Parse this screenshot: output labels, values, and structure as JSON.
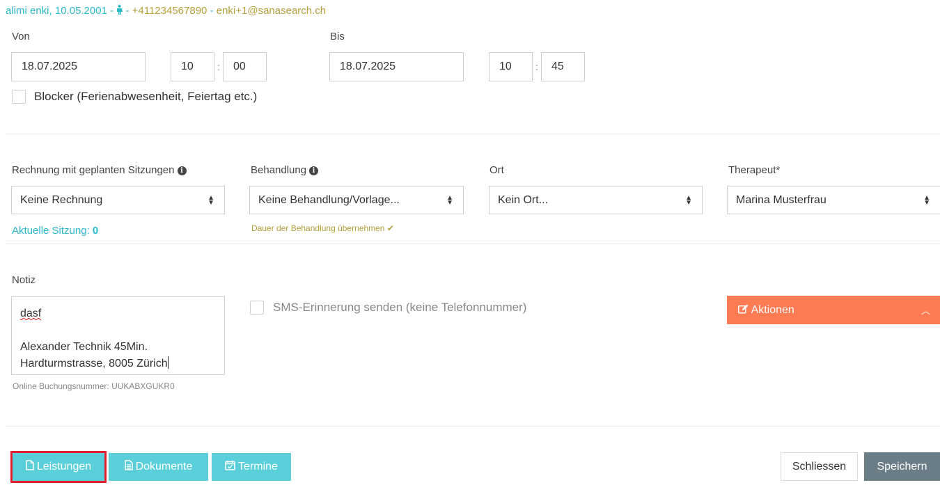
{
  "patient": {
    "name_dob": "alimi enki, 10.05.2001",
    "separator": " - ",
    "phone": "+411234567890",
    "email": "enki+1@sanasearch.ch"
  },
  "time": {
    "from_label": "Von",
    "from_date": "18.07.2025",
    "from_hour": "10",
    "from_minute": "00",
    "to_label": "Bis",
    "to_date": "18.07.2025",
    "to_hour": "10",
    "to_minute": "45",
    "colon": ":"
  },
  "blocker_label": "Blocker (Ferienabwesenheit, Feiertag etc.)",
  "rechnung": {
    "label": "Rechnung mit geplanten Sitzungen",
    "value": "Keine Rechnung",
    "current_label": "Aktuelle Sitzung:",
    "current_value": "0"
  },
  "behandlung": {
    "label": "Behandlung",
    "value": "Keine Behandlung/Vorlage...",
    "duration_link": "Dauer der Behandlung übernehmen"
  },
  "ort": {
    "label": "Ort",
    "value": "Kein Ort..."
  },
  "therapeut": {
    "label": "Therapeut*",
    "value": "Marina Musterfrau"
  },
  "notiz": {
    "label": "Notiz",
    "line1": "dasf",
    "line2": "Alexander Technik 45Min.",
    "line3": "Hardturmstrasse, 8005 Zürich",
    "booking_number": "Online Buchungsnummer: UUKABXGUKR0"
  },
  "sms_label": "SMS-Erinnerung senden (keine Telefonnummer)",
  "aktionen_label": "Aktionen",
  "footer": {
    "leistungen": "Leistungen",
    "dokumente": "Dokumente",
    "termine": "Termine",
    "schliessen": "Schliessen",
    "speichern": "Speichern"
  },
  "colors": {
    "teal": "#2bb8c9",
    "gold": "#b5a03a",
    "orange": "#ff7b54",
    "button_teal": "#5bcfd9",
    "button_dark": "#6b7e87",
    "highlight_red": "#e02030"
  },
  "icons": {
    "patient_gender": "female-icon",
    "info": "info-circle-icon",
    "check": "checkmark-icon",
    "edit": "edit-icon",
    "chevron": "chevron-up-icon",
    "file": "file-icon",
    "document": "document-icon",
    "calendar": "calendar-check-icon"
  }
}
